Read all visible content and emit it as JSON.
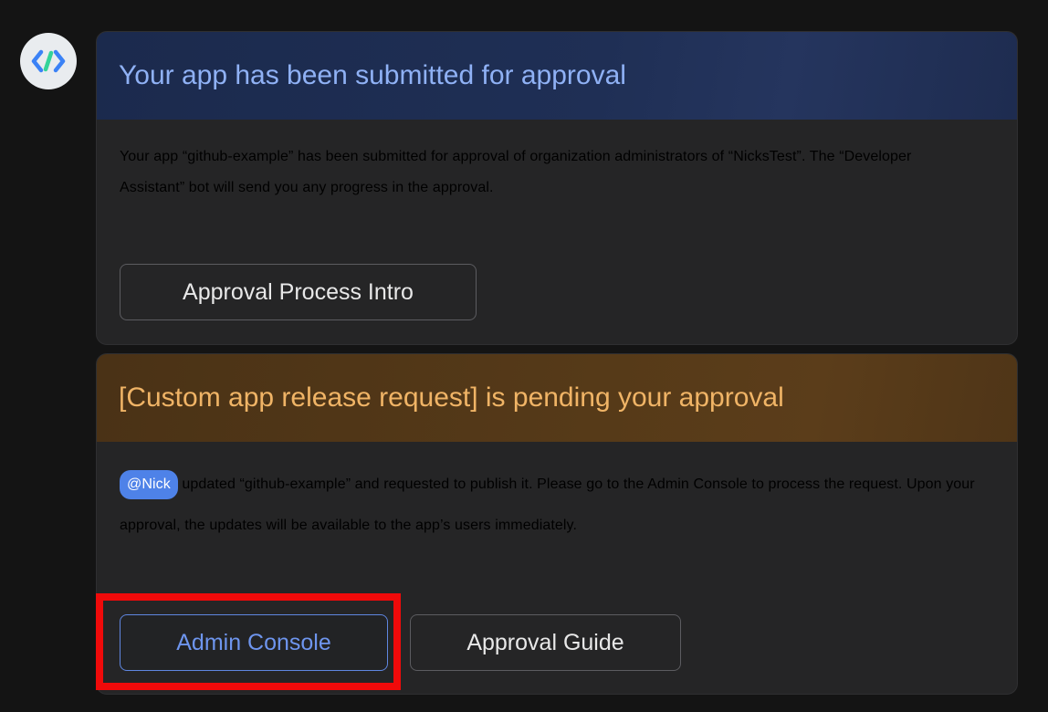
{
  "bot": {
    "avatar_icon": "code-brackets-icon",
    "accent_colors": [
      "#3b82f6",
      "#34d399"
    ]
  },
  "cards": [
    {
      "title": "Your app has been submitted for approval",
      "body": "Your app “github-example” has been submitted for approval of organization administrators of “NicksTest”. The “Developer Assistant” bot will send you any progress in the approval.",
      "header_color": "#1f2f55",
      "title_color": "#8fb1f5",
      "buttons": [
        {
          "label": "Approval Process Intro"
        }
      ]
    },
    {
      "title": "[Custom app release request] is pending your approval",
      "mention": "@Nick",
      "body": " updated “github-example” and requested to publish it. Please go to the Admin Console to process the request. Upon your approval, the updates will be available to the app’s users immediately.",
      "header_color": "#563a18",
      "title_color": "#f0b466",
      "mention_color": "#4e82e8",
      "buttons": [
        {
          "label": "Admin Console",
          "highlighted": true
        },
        {
          "label": "Approval Guide"
        }
      ]
    }
  ],
  "annotation": {
    "highlight_color": "#f00a0a",
    "target": "Admin Console"
  }
}
